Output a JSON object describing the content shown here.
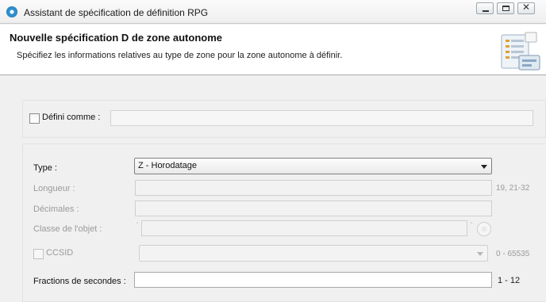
{
  "window": {
    "title": "Assistant de spécification de définition RPG",
    "controls": {
      "minimize": "",
      "maximize": "",
      "close": "✕"
    }
  },
  "header": {
    "title": "Nouvelle spécification D de zone autonome",
    "description": "Spécifiez les informations relatives au type de zone pour la zone autonome à définir.",
    "icon": "wizard-banner-icon"
  },
  "form": {
    "defini_comme": {
      "label": "Défini comme :",
      "checked": false,
      "value": ""
    },
    "type": {
      "label": "Type :",
      "value": "Z - Horodatage"
    },
    "longueur": {
      "label": "Longueur :",
      "value": "",
      "hint": "19, 21-32"
    },
    "decimales": {
      "label": "Décimales :",
      "value": ""
    },
    "classe_objet": {
      "label": "Classe de l'objet :",
      "open_quote": "'",
      "close_quote": "'",
      "value": ""
    },
    "ccsid": {
      "label": "CCSID",
      "checked": false,
      "value": "",
      "hint": "0 - 65535"
    },
    "fractions": {
      "label": "Fractions de secondes :",
      "value": "",
      "hint": "1 - 12"
    }
  }
}
